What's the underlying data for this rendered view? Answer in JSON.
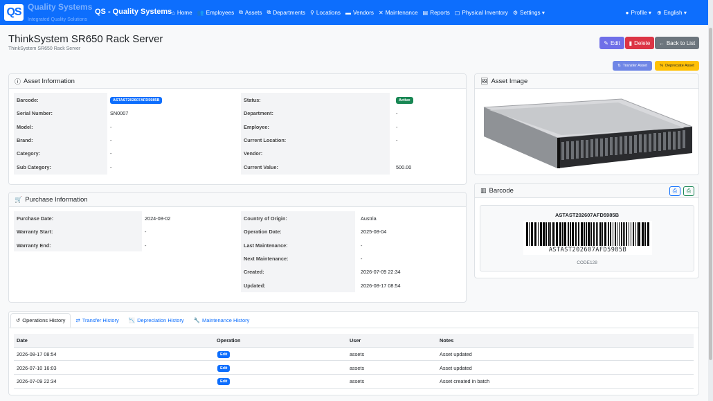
{
  "nav": {
    "logo_text": "QS",
    "logo_title": "Quality Systems",
    "logo_subtitle": "Integrated Quality Solutions",
    "brand": "QS - Quality Systems",
    "items": [
      {
        "icon": "home-icon",
        "glyph": "⌂",
        "label": "Home"
      },
      {
        "icon": "users-icon",
        "glyph": "👥",
        "label": "Employees"
      },
      {
        "icon": "sitemap-icon",
        "glyph": "⧉",
        "label": "Assets"
      },
      {
        "icon": "sitemap-icon",
        "glyph": "⧉",
        "label": "Departments"
      },
      {
        "icon": "map-marker-icon",
        "glyph": "⚲",
        "label": "Locations"
      },
      {
        "icon": "truck-icon",
        "glyph": "▬",
        "label": "Vendors"
      },
      {
        "icon": "tools-icon",
        "glyph": "✕",
        "label": "Maintenance"
      },
      {
        "icon": "chart-icon",
        "glyph": "▤",
        "label": "Reports"
      },
      {
        "icon": "clipboard-icon",
        "glyph": "▢",
        "label": "Physical Inventory"
      },
      {
        "icon": "gears-icon",
        "glyph": "⚙",
        "label": "Settings ▾"
      }
    ],
    "profile": "Profile ▾",
    "language": "English ▾"
  },
  "page": {
    "title": "ThinkSystem SR650 Rack Server",
    "subtitle": "ThinkSystem SR650 Rack Server"
  },
  "actions": {
    "edit": "Edit",
    "delete": "Delete",
    "back": "Back to List",
    "transfer": "Transfer Asset",
    "depreciate": "Depreciate Asset"
  },
  "asset_info": {
    "title": "Asset Information",
    "left": [
      {
        "label": "Barcode:",
        "value": "ASTAST202607AFD5985B",
        "badge": true
      },
      {
        "label": "Serial Number:",
        "value": "SN0007"
      },
      {
        "label": "Model:",
        "value": "-"
      },
      {
        "label": "Brand:",
        "value": "-"
      },
      {
        "label": "Category:",
        "value": "-"
      },
      {
        "label": "Sub Category:",
        "value": "-"
      }
    ],
    "right": [
      {
        "label": "Status:",
        "value": "Active",
        "badge": true
      },
      {
        "label": "Department:",
        "value": "-"
      },
      {
        "label": "Employee:",
        "value": "-"
      },
      {
        "label": "Current Location:",
        "value": "-"
      },
      {
        "label": "Vendor:",
        "value": ""
      },
      {
        "label": "Current Value:",
        "value": "500.00"
      }
    ]
  },
  "purchase_info": {
    "title": "Purchase Information",
    "left": [
      {
        "label": "Purchase Date:",
        "value": "2024-08-02"
      },
      {
        "label": "Warranty Start:",
        "value": "-"
      },
      {
        "label": "Warranty End:",
        "value": "-"
      }
    ],
    "right": [
      {
        "label": "Country of Origin:",
        "value": "Austria"
      },
      {
        "label": "Operation Date:",
        "value": "2025-08-04"
      },
      {
        "label": "Last Maintenance:",
        "value": "-"
      },
      {
        "label": "Next Maintenance:",
        "value": "-"
      },
      {
        "label": "Created:",
        "value": "2026-07-09 22:34"
      },
      {
        "label": "Updated:",
        "value": "2026-08-17 08:54"
      }
    ]
  },
  "asset_image": {
    "title": "Asset Image"
  },
  "barcode": {
    "title": "Barcode",
    "value": "ASTAST202607AFD5985B",
    "type": "CODE128"
  },
  "history": {
    "tabs": [
      {
        "icon": "history-icon",
        "glyph": "↺",
        "label": "Operations History"
      },
      {
        "icon": "exchange-icon",
        "glyph": "⇄",
        "label": "Transfer History"
      },
      {
        "icon": "chart-line-icon",
        "glyph": "📉",
        "label": "Depreciation History"
      },
      {
        "icon": "wrench-icon",
        "glyph": "🔧",
        "label": "Maintenance History"
      }
    ],
    "columns": [
      "Date",
      "Operation",
      "User",
      "Notes"
    ],
    "rows": [
      {
        "date": "2026-08-17 08:54",
        "operation": "Edit",
        "user": "assets",
        "notes": "Asset updated"
      },
      {
        "date": "2026-07-10 16:03",
        "operation": "Edit",
        "user": "assets",
        "notes": "Asset updated"
      },
      {
        "date": "2026-07-09 22:34",
        "operation": "Edit",
        "user": "assets",
        "notes": "Asset created in batch"
      }
    ]
  }
}
